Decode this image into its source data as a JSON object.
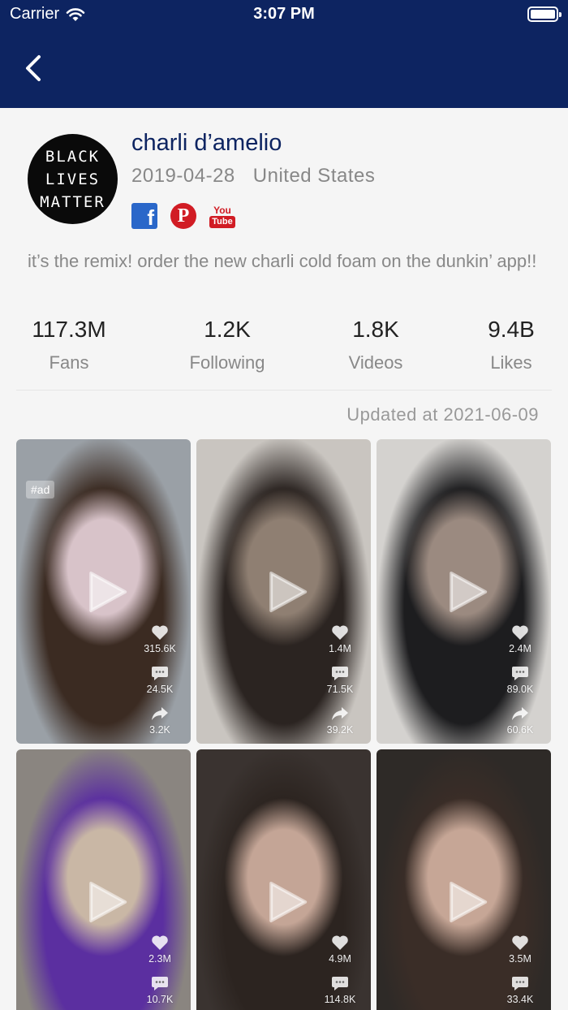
{
  "status_bar": {
    "carrier": "Carrier",
    "time": "3:07 PM"
  },
  "profile": {
    "avatar_lines": [
      "BLACK",
      "LIVES",
      "MATTER"
    ],
    "name": "charli d’amelio",
    "joined": "2019-04-28",
    "country": "United States",
    "socials": [
      {
        "icon": "facebook-icon",
        "glyph": "f"
      },
      {
        "icon": "pinterest-icon",
        "glyph": "P"
      },
      {
        "icon": "youtube-icon",
        "you": "You",
        "tube": "Tube"
      }
    ],
    "bio": "it’s the remix! order the new charli cold foam on the dunkin’ app!!"
  },
  "stats": [
    {
      "value": "117.3M",
      "label": "Fans"
    },
    {
      "value": "1.2K",
      "label": "Following"
    },
    {
      "value": "1.8K",
      "label": "Videos"
    },
    {
      "value": "9.4B",
      "label": "Likes"
    }
  ],
  "updated": "Updated at 2021-06-09",
  "videos": [
    {
      "ad": "#ad",
      "likes": "315.6K",
      "comments": "24.5K",
      "shares": "3.2K",
      "colors": [
        "#9aa0a6",
        "#d8c3c9",
        "#3b2b22"
      ]
    },
    {
      "ad": "",
      "likes": "1.4M",
      "comments": "71.5K",
      "shares": "39.2K",
      "colors": [
        "#c9c5c0",
        "#8f7f72",
        "#2b2421"
      ]
    },
    {
      "ad": "",
      "likes": "2.4M",
      "comments": "89.0K",
      "shares": "60.6K",
      "colors": [
        "#d4d2cf",
        "#9b8a80",
        "#1d1d1f"
      ]
    },
    {
      "ad": "",
      "likes": "2.3M",
      "comments": "10.7K",
      "shares": "",
      "colors": [
        "#8a8580",
        "#c9b7a5",
        "#5b2fa0"
      ]
    },
    {
      "ad": "",
      "likes": "4.9M",
      "comments": "114.8K",
      "shares": "",
      "colors": [
        "#3a3330",
        "#c4a596",
        "#2c2420"
      ]
    },
    {
      "ad": "",
      "likes": "3.5M",
      "comments": "33.4K",
      "shares": "",
      "colors": [
        "#2e2a27",
        "#c6a696",
        "#3a2d27"
      ]
    }
  ]
}
